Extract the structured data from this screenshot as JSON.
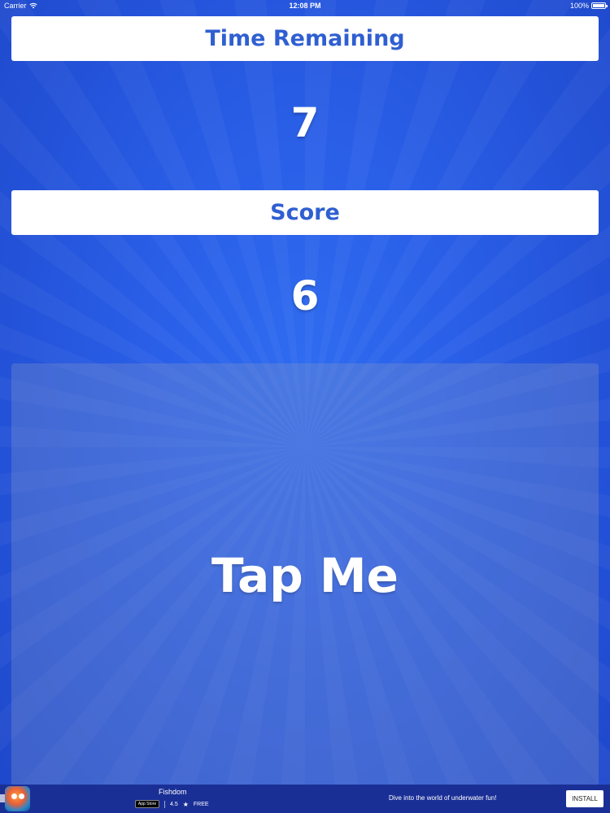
{
  "status_bar": {
    "carrier": "Carrier",
    "time": "12:08 PM",
    "battery": "100%"
  },
  "game": {
    "time_label": "Time Remaining",
    "time_value": "7",
    "score_label": "Score",
    "score_value": "6",
    "tap_label": "Tap Me"
  },
  "ad": {
    "title": "Fishdom",
    "store_badge": "App Store",
    "rating": "4.5",
    "price": "FREE",
    "tagline": "Dive into the world of underwater fun!",
    "install_label": "INSTALL"
  },
  "colors": {
    "background": "#2a5fe8",
    "label_text": "#2f5fd1",
    "ad_background": "#1a2f96"
  },
  "icons": {
    "wifi": "wifi-icon",
    "battery": "battery-icon",
    "star": "star-icon"
  }
}
